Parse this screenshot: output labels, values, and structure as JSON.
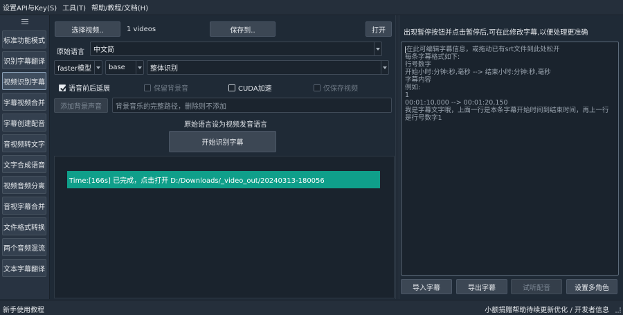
{
  "menubar": {
    "items": [
      "设置API与Key(S)",
      "工具(T)",
      "帮助/教程/文档(H)"
    ]
  },
  "leftnav": {
    "items": [
      {
        "label": "标准功能模式"
      },
      {
        "label": "识别字幕翻译"
      },
      {
        "label": "视频识别字幕",
        "active": true
      },
      {
        "label": "字幕视频合并"
      },
      {
        "label": "字幕创建配音"
      },
      {
        "label": "音视频转文字"
      },
      {
        "label": "文字合成语音"
      },
      {
        "label": "视频音频分离"
      },
      {
        "label": "音视字幕合并"
      },
      {
        "label": "文件格式转换"
      },
      {
        "label": "两个音频混流"
      },
      {
        "label": "文本字幕翻译"
      }
    ]
  },
  "center": {
    "select_video_label": "选择视频..",
    "video_count": "1 videos",
    "save_to_label": "保存到..",
    "open_label": "打开",
    "source_lang_label": "原始语言",
    "source_lang_value": "中文简",
    "model_type_value": "faster模型",
    "model_size_value": "base",
    "recognition_mode_value": "整体识别",
    "chk_pad_speech": "语音前后延展",
    "chk_keep_bg": "保留背景音",
    "chk_cuda": "CUDA加速",
    "chk_save_video_only": "仅保存视频",
    "add_bg_audio_label": "添加背景声音",
    "bg_audio_placeholder": "背景音乐的完整路径，删除则不添加",
    "hint_text": "原始语言设为视频发音语言",
    "start_button_label": "开始识别字幕",
    "done_message": "Time:[166s] 已完成，点击打开 D:/Downloads/_video_out/20240313-180056"
  },
  "right": {
    "title": "出现暂停按钮并点击暂停后,可在此修改字幕,以便处理更准确",
    "editor_placeholder_lines": [
      "在此可编辑字幕信息，或拖动已有srt文件到此处松开",
      "",
      "每条字幕格式如下:",
      "",
      "行号数字",
      "开始小时:分钟:秒,毫秒 --> 结束小时:分钟:秒,毫秒",
      "字幕内容",
      "",
      "例如:",
      "",
      "1",
      "00:01:10,000 --> 00:01:20,150",
      "我是字幕文字哦，上面一行是本条字幕开始时间到结束时间，再上一行是行号数字1"
    ],
    "import_label": "导入字幕",
    "export_label": "导出字幕",
    "preview_dub_label": "试听配音",
    "set_roles_label": "设置多角色"
  },
  "statusbar": {
    "left": "新手使用教程",
    "right": "小额捐赠帮助待续更新优化 / 开发者信息"
  },
  "colors": {
    "background": "#1f2a36",
    "success": "#0f9f8a",
    "button": "#3c4754"
  }
}
